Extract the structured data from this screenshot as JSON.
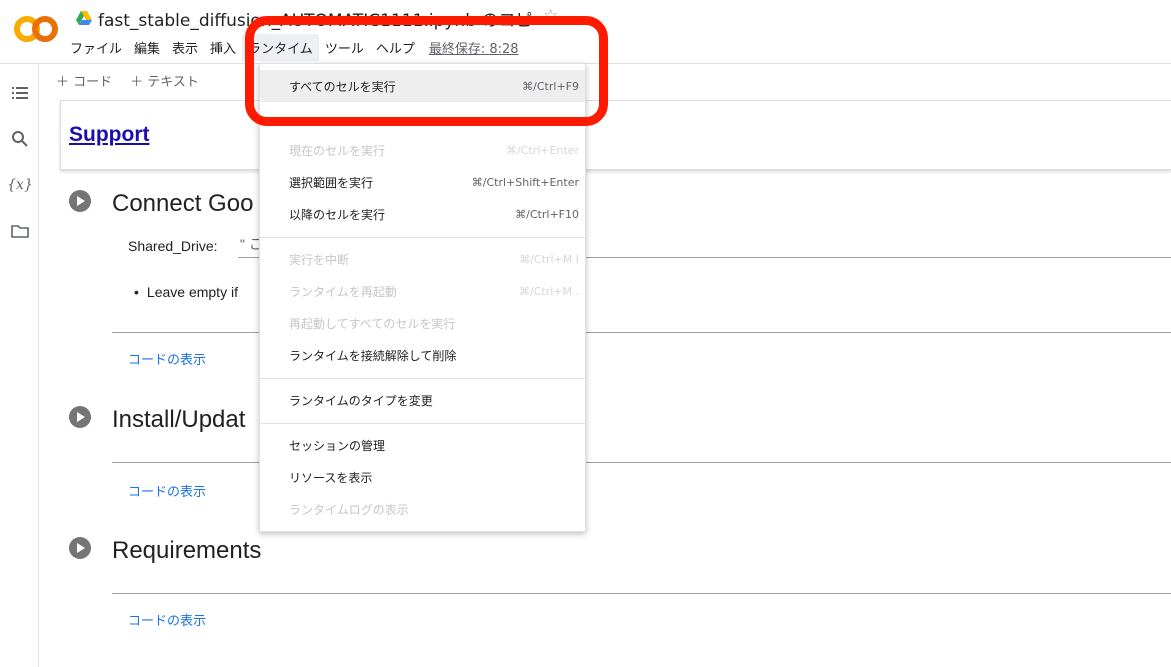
{
  "app": {
    "title": "fast_stable_diffusion_AUTOMATIC1111.ipynb のコピー",
    "logo_text": "CO"
  },
  "menubar": {
    "items": [
      "ファイル",
      "編集",
      "表示",
      "挿入",
      "ランタイム",
      "ツール",
      "ヘルプ"
    ],
    "active": "ランタイム",
    "last_saved": "最終保存: 8:28"
  },
  "toolbar": {
    "add_code": "＋ コード",
    "add_text": "＋ テキスト"
  },
  "rail": {
    "icons": [
      "toc-icon",
      "search-icon",
      "variables-icon",
      "folder-icon"
    ],
    "variables_label": "{x}"
  },
  "notebook": {
    "support_link": "Support",
    "sections": [
      {
        "title": "Connect Goo",
        "show_code": "コードの表示"
      },
      {
        "title": "Install/Updat",
        "show_code": "コードの表示"
      },
      {
        "title": "Requirements",
        "show_code": "コードの表示"
      }
    ],
    "form": {
      "label": "Shared_Drive:",
      "value": "\" こ"
    },
    "bullet": "Leave empty if"
  },
  "dropdown": {
    "items": [
      {
        "label": "すべてのセルを実行",
        "shortcut": "⌘/Ctrl+F9",
        "disabled": false
      },
      {
        "label": "現在のセルを実行",
        "shortcut": "⌘/Ctrl+Enter",
        "disabled": true
      },
      {
        "label": "選択範囲を実行",
        "shortcut": "⌘/Ctrl+Shift+Enter",
        "disabled": false
      },
      {
        "label": "以降のセルを実行",
        "shortcut": "⌘/Ctrl+F10",
        "disabled": false
      },
      {
        "label": "実行を中断",
        "shortcut": "⌘/Ctrl+M I",
        "disabled": true
      },
      {
        "label": "ランタイムを再起動",
        "shortcut": "⌘/Ctrl+M .",
        "disabled": true
      },
      {
        "label": "再起動してすべてのセルを実行",
        "shortcut": "",
        "disabled": true
      },
      {
        "label": "ランタイムを接続解除して削除",
        "shortcut": "",
        "disabled": false
      },
      {
        "label": "ランタイムのタイプを変更",
        "shortcut": "",
        "disabled": false
      },
      {
        "label": "セッションの管理",
        "shortcut": "",
        "disabled": false
      },
      {
        "label": "リソースを表示",
        "shortcut": "",
        "disabled": false
      },
      {
        "label": "ランタイムログの表示",
        "shortcut": "",
        "disabled": true
      }
    ]
  },
  "colors": {
    "highlight": "#ff1a00",
    "link": "#1a73e8",
    "logo_orange": "#f9ab00",
    "logo_dark": "#e8710a"
  }
}
